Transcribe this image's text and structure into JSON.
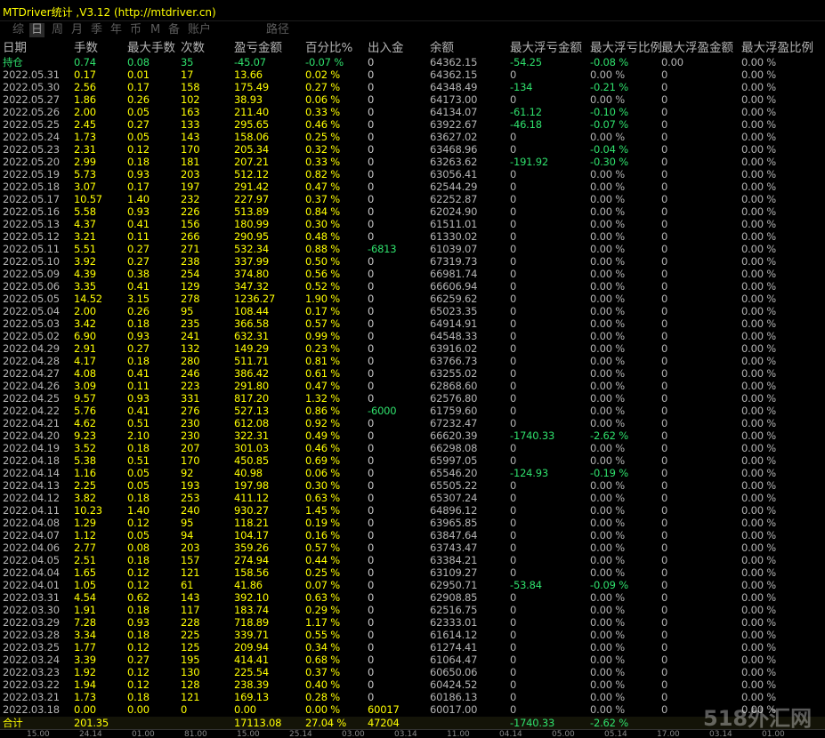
{
  "window": {
    "title": "MTDriver统计  ,V3.12 (http://mtdriver.cn)"
  },
  "tabs": [
    {
      "label": "综",
      "active": false
    },
    {
      "label": "日",
      "active": true
    },
    {
      "label": "周",
      "active": false
    },
    {
      "label": "月",
      "active": false
    },
    {
      "label": "季",
      "active": false
    },
    {
      "label": "年",
      "active": false
    },
    {
      "label": "币",
      "active": false
    },
    {
      "label": "M",
      "active": false
    },
    {
      "label": "备",
      "active": false
    },
    {
      "label": "账户",
      "active": false
    },
    {
      "label": "路径",
      "active": false
    }
  ],
  "columns": [
    "日期",
    "手数",
    "最大手数",
    "次数",
    "盈亏金额",
    "百分比%",
    "出入金",
    "余额",
    "最大浮亏金额",
    "最大浮亏比例",
    "最大浮盈金额",
    "最大浮盈比例"
  ],
  "holding": [
    "持仓",
    "0.74",
    "0.08",
    "35",
    "-45.07",
    "-0.07 %",
    "0",
    "64362.15",
    "-54.25",
    "-0.08 %",
    "0.00",
    "0.00 %"
  ],
  "rows": [
    [
      "2022.05.31",
      "0.17",
      "0.01",
      "17",
      "13.66",
      "0.02 %",
      "0",
      "64362.15",
      "0",
      "0.00 %",
      "0",
      "0.00 %"
    ],
    [
      "2022.05.30",
      "2.56",
      "0.17",
      "158",
      "175.49",
      "0.27 %",
      "0",
      "64348.49",
      "-134",
      "-0.21 %",
      "0",
      "0.00 %"
    ],
    [
      "2022.05.27",
      "1.86",
      "0.26",
      "102",
      "38.93",
      "0.06 %",
      "0",
      "64173.00",
      "0",
      "0.00 %",
      "0",
      "0.00 %"
    ],
    [
      "2022.05.26",
      "2.00",
      "0.05",
      "163",
      "211.40",
      "0.33 %",
      "0",
      "64134.07",
      "-61.12",
      "-0.10 %",
      "0",
      "0.00 %"
    ],
    [
      "2022.05.25",
      "2.45",
      "0.27",
      "133",
      "295.65",
      "0.46 %",
      "0",
      "63922.67",
      "-46.18",
      "-0.07 %",
      "0",
      "0.00 %"
    ],
    [
      "2022.05.24",
      "1.73",
      "0.05",
      "143",
      "158.06",
      "0.25 %",
      "0",
      "63627.02",
      "0",
      "0.00 %",
      "0",
      "0.00 %"
    ],
    [
      "2022.05.23",
      "2.31",
      "0.12",
      "170",
      "205.34",
      "0.32 %",
      "0",
      "63468.96",
      "0",
      "-0.04 %",
      "0",
      "0.00 %"
    ],
    [
      "2022.05.20",
      "2.99",
      "0.18",
      "181",
      "207.21",
      "0.33 %",
      "0",
      "63263.62",
      "-191.92",
      "-0.30 %",
      "0",
      "0.00 %"
    ],
    [
      "2022.05.19",
      "5.73",
      "0.93",
      "203",
      "512.12",
      "0.82 %",
      "0",
      "63056.41",
      "0",
      "0.00 %",
      "0",
      "0.00 %"
    ],
    [
      "2022.05.18",
      "3.07",
      "0.17",
      "197",
      "291.42",
      "0.47 %",
      "0",
      "62544.29",
      "0",
      "0.00 %",
      "0",
      "0.00 %"
    ],
    [
      "2022.05.17",
      "10.57",
      "1.40",
      "232",
      "227.97",
      "0.37 %",
      "0",
      "62252.87",
      "0",
      "0.00 %",
      "0",
      "0.00 %"
    ],
    [
      "2022.05.16",
      "5.58",
      "0.93",
      "226",
      "513.89",
      "0.84 %",
      "0",
      "62024.90",
      "0",
      "0.00 %",
      "0",
      "0.00 %"
    ],
    [
      "2022.05.13",
      "4.37",
      "0.41",
      "156",
      "180.99",
      "0.30 %",
      "0",
      "61511.01",
      "0",
      "0.00 %",
      "0",
      "0.00 %"
    ],
    [
      "2022.05.12",
      "3.21",
      "0.11",
      "266",
      "290.95",
      "0.48 %",
      "0",
      "61330.02",
      "0",
      "0.00 %",
      "0",
      "0.00 %"
    ],
    [
      "2022.05.11",
      "5.51",
      "0.27",
      "271",
      "532.34",
      "0.88 %",
      "-6813",
      "61039.07",
      "0",
      "0.00 %",
      "0",
      "0.00 %"
    ],
    [
      "2022.05.10",
      "3.92",
      "0.27",
      "238",
      "337.99",
      "0.50 %",
      "0",
      "67319.73",
      "0",
      "0.00 %",
      "0",
      "0.00 %"
    ],
    [
      "2022.05.09",
      "4.39",
      "0.38",
      "254",
      "374.80",
      "0.56 %",
      "0",
      "66981.74",
      "0",
      "0.00 %",
      "0",
      "0.00 %"
    ],
    [
      "2022.05.06",
      "3.35",
      "0.41",
      "129",
      "347.32",
      "0.52 %",
      "0",
      "66606.94",
      "0",
      "0.00 %",
      "0",
      "0.00 %"
    ],
    [
      "2022.05.05",
      "14.52",
      "3.15",
      "278",
      "1236.27",
      "1.90 %",
      "0",
      "66259.62",
      "0",
      "0.00 %",
      "0",
      "0.00 %"
    ],
    [
      "2022.05.04",
      "2.00",
      "0.26",
      "95",
      "108.44",
      "0.17 %",
      "0",
      "65023.35",
      "0",
      "0.00 %",
      "0",
      "0.00 %"
    ],
    [
      "2022.05.03",
      "3.42",
      "0.18",
      "235",
      "366.58",
      "0.57 %",
      "0",
      "64914.91",
      "0",
      "0.00 %",
      "0",
      "0.00 %"
    ],
    [
      "2022.05.02",
      "6.90",
      "0.93",
      "241",
      "632.31",
      "0.99 %",
      "0",
      "64548.33",
      "0",
      "0.00 %",
      "0",
      "0.00 %"
    ],
    [
      "2022.04.29",
      "2.91",
      "0.27",
      "132",
      "149.29",
      "0.23 %",
      "0",
      "63916.02",
      "0",
      "0.00 %",
      "0",
      "0.00 %"
    ],
    [
      "2022.04.28",
      "4.17",
      "0.18",
      "280",
      "511.71",
      "0.81 %",
      "0",
      "63766.73",
      "0",
      "0.00 %",
      "0",
      "0.00 %"
    ],
    [
      "2022.04.27",
      "4.08",
      "0.41",
      "246",
      "386.42",
      "0.61 %",
      "0",
      "63255.02",
      "0",
      "0.00 %",
      "0",
      "0.00 %"
    ],
    [
      "2022.04.26",
      "3.09",
      "0.11",
      "223",
      "291.80",
      "0.47 %",
      "0",
      "62868.60",
      "0",
      "0.00 %",
      "0",
      "0.00 %"
    ],
    [
      "2022.04.25",
      "9.57",
      "0.93",
      "331",
      "817.20",
      "1.32 %",
      "0",
      "62576.80",
      "0",
      "0.00 %",
      "0",
      "0.00 %"
    ],
    [
      "2022.04.22",
      "5.76",
      "0.41",
      "276",
      "527.13",
      "0.86 %",
      "-6000",
      "61759.60",
      "0",
      "0.00 %",
      "0",
      "0.00 %"
    ],
    [
      "2022.04.21",
      "4.62",
      "0.51",
      "230",
      "612.08",
      "0.92 %",
      "0",
      "67232.47",
      "0",
      "0.00 %",
      "0",
      "0.00 %"
    ],
    [
      "2022.04.20",
      "9.23",
      "2.10",
      "230",
      "322.31",
      "0.49 %",
      "0",
      "66620.39",
      "-1740.33",
      "-2.62 %",
      "0",
      "0.00 %"
    ],
    [
      "2022.04.19",
      "3.52",
      "0.18",
      "207",
      "301.03",
      "0.46 %",
      "0",
      "66298.08",
      "0",
      "0.00 %",
      "0",
      "0.00 %"
    ],
    [
      "2022.04.18",
      "5.38",
      "0.51",
      "170",
      "450.85",
      "0.69 %",
      "0",
      "65997.05",
      "0",
      "0.00 %",
      "0",
      "0.00 %"
    ],
    [
      "2022.04.14",
      "1.16",
      "0.05",
      "92",
      "40.98",
      "0.06 %",
      "0",
      "65546.20",
      "-124.93",
      "-0.19 %",
      "0",
      "0.00 %"
    ],
    [
      "2022.04.13",
      "2.25",
      "0.05",
      "193",
      "197.98",
      "0.30 %",
      "0",
      "65505.22",
      "0",
      "0.00 %",
      "0",
      "0.00 %"
    ],
    [
      "2022.04.12",
      "3.82",
      "0.18",
      "253",
      "411.12",
      "0.63 %",
      "0",
      "65307.24",
      "0",
      "0.00 %",
      "0",
      "0.00 %"
    ],
    [
      "2022.04.11",
      "10.23",
      "1.40",
      "240",
      "930.27",
      "1.45 %",
      "0",
      "64896.12",
      "0",
      "0.00 %",
      "0",
      "0.00 %"
    ],
    [
      "2022.04.08",
      "1.29",
      "0.12",
      "95",
      "118.21",
      "0.19 %",
      "0",
      "63965.85",
      "0",
      "0.00 %",
      "0",
      "0.00 %"
    ],
    [
      "2022.04.07",
      "1.12",
      "0.05",
      "94",
      "104.17",
      "0.16 %",
      "0",
      "63847.64",
      "0",
      "0.00 %",
      "0",
      "0.00 %"
    ],
    [
      "2022.04.06",
      "2.77",
      "0.08",
      "203",
      "359.26",
      "0.57 %",
      "0",
      "63743.47",
      "0",
      "0.00 %",
      "0",
      "0.00 %"
    ],
    [
      "2022.04.05",
      "2.51",
      "0.18",
      "157",
      "274.94",
      "0.44 %",
      "0",
      "63384.21",
      "0",
      "0.00 %",
      "0",
      "0.00 %"
    ],
    [
      "2022.04.04",
      "1.65",
      "0.12",
      "121",
      "158.56",
      "0.25 %",
      "0",
      "63109.27",
      "0",
      "0.00 %",
      "0",
      "0.00 %"
    ],
    [
      "2022.04.01",
      "1.05",
      "0.12",
      "61",
      "41.86",
      "0.07 %",
      "0",
      "62950.71",
      "-53.84",
      "-0.09 %",
      "0",
      "0.00 %"
    ],
    [
      "2022.03.31",
      "4.54",
      "0.62",
      "143",
      "392.10",
      "0.63 %",
      "0",
      "62908.85",
      "0",
      "0.00 %",
      "0",
      "0.00 %"
    ],
    [
      "2022.03.30",
      "1.91",
      "0.18",
      "117",
      "183.74",
      "0.29 %",
      "0",
      "62516.75",
      "0",
      "0.00 %",
      "0",
      "0.00 %"
    ],
    [
      "2022.03.29",
      "7.28",
      "0.93",
      "228",
      "718.89",
      "1.17 %",
      "0",
      "62333.01",
      "0",
      "0.00 %",
      "0",
      "0.00 %"
    ],
    [
      "2022.03.28",
      "3.34",
      "0.18",
      "225",
      "339.71",
      "0.55 %",
      "0",
      "61614.12",
      "0",
      "0.00 %",
      "0",
      "0.00 %"
    ],
    [
      "2022.03.25",
      "1.77",
      "0.12",
      "125",
      "209.94",
      "0.34 %",
      "0",
      "61274.41",
      "0",
      "0.00 %",
      "0",
      "0.00 %"
    ],
    [
      "2022.03.24",
      "3.39",
      "0.27",
      "195",
      "414.41",
      "0.68 %",
      "0",
      "61064.47",
      "0",
      "0.00 %",
      "0",
      "0.00 %"
    ],
    [
      "2022.03.23",
      "1.92",
      "0.12",
      "130",
      "225.54",
      "0.37 %",
      "0",
      "60650.06",
      "0",
      "0.00 %",
      "0",
      "0.00 %"
    ],
    [
      "2022.03.22",
      "1.94",
      "0.12",
      "128",
      "238.39",
      "0.40 %",
      "0",
      "60424.52",
      "0",
      "0.00 %",
      "0",
      "0.00 %"
    ],
    [
      "2022.03.21",
      "1.73",
      "0.18",
      "121",
      "169.13",
      "0.28 %",
      "0",
      "60186.13",
      "0",
      "0.00 %",
      "0",
      "0.00 %"
    ],
    [
      "2022.03.18",
      "0.00",
      "0.00",
      "0",
      "0.00",
      "0.00 %",
      "60017",
      "60017.00",
      "0",
      "0.00 %",
      "0",
      "0.00 %"
    ]
  ],
  "total": [
    "合计",
    "201.35",
    "",
    "",
    "17113.08",
    "27.04 %",
    "47204",
    "",
    "-1740.33",
    "-2.62 %",
    "",
    ""
  ],
  "bottom_ticks": [
    "15.00",
    "24.14",
    "01.00",
    "81.00",
    "15.00",
    "25.14",
    "03.00",
    "03.14",
    "11.00",
    "04.14",
    "05.00",
    "05.14",
    "17.00",
    "03.14",
    "01.00"
  ],
  "watermark": "518外汇网",
  "colors": {
    "background": "#000000",
    "value_yellow": "#ffff00",
    "negative_green": "#2fe06c",
    "label_gray": "#b4b4b4"
  }
}
